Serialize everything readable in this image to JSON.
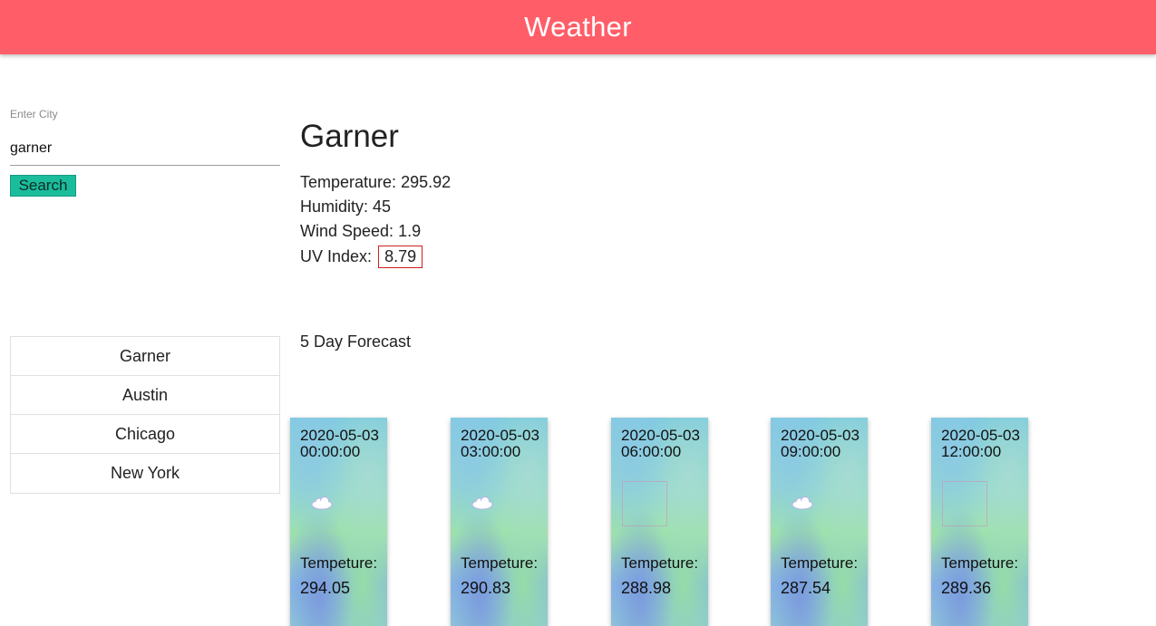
{
  "header": {
    "title": "Weather"
  },
  "search": {
    "label": "Enter City",
    "value": "garner",
    "button_label": "Search"
  },
  "history": [
    {
      "label": "Garner"
    },
    {
      "label": "Austin"
    },
    {
      "label": "Chicago"
    },
    {
      "label": "New York"
    }
  ],
  "current": {
    "city": "Garner",
    "temperature_label": "Temperature:",
    "temperature": "295.92",
    "humidity_label": "Humidity:",
    "humidity": "45",
    "wind_label": "Wind Speed:",
    "wind": "1.9",
    "uv_label": "UV Index:",
    "uv": "8.79"
  },
  "forecast": {
    "title": "5 Day Forecast",
    "temp_label": "Tempeture:",
    "cards": [
      {
        "date": "2020-05-03 00:00:00",
        "temp": "294.05",
        "icon": "cloud-icon"
      },
      {
        "date": "2020-05-03 03:00:00",
        "temp": "290.83",
        "icon": "cloud-icon"
      },
      {
        "date": "2020-05-03 06:00:00",
        "temp": "288.98",
        "icon": "missing-image-icon"
      },
      {
        "date": "2020-05-03 09:00:00",
        "temp": "287.54",
        "icon": "cloud-icon"
      },
      {
        "date": "2020-05-03 12:00:00",
        "temp": "289.36",
        "icon": "missing-image-icon"
      }
    ]
  },
  "colors": {
    "header": "#ff5e69",
    "search_button": "#1abc9c",
    "uv_border": "#cc1f1f"
  }
}
